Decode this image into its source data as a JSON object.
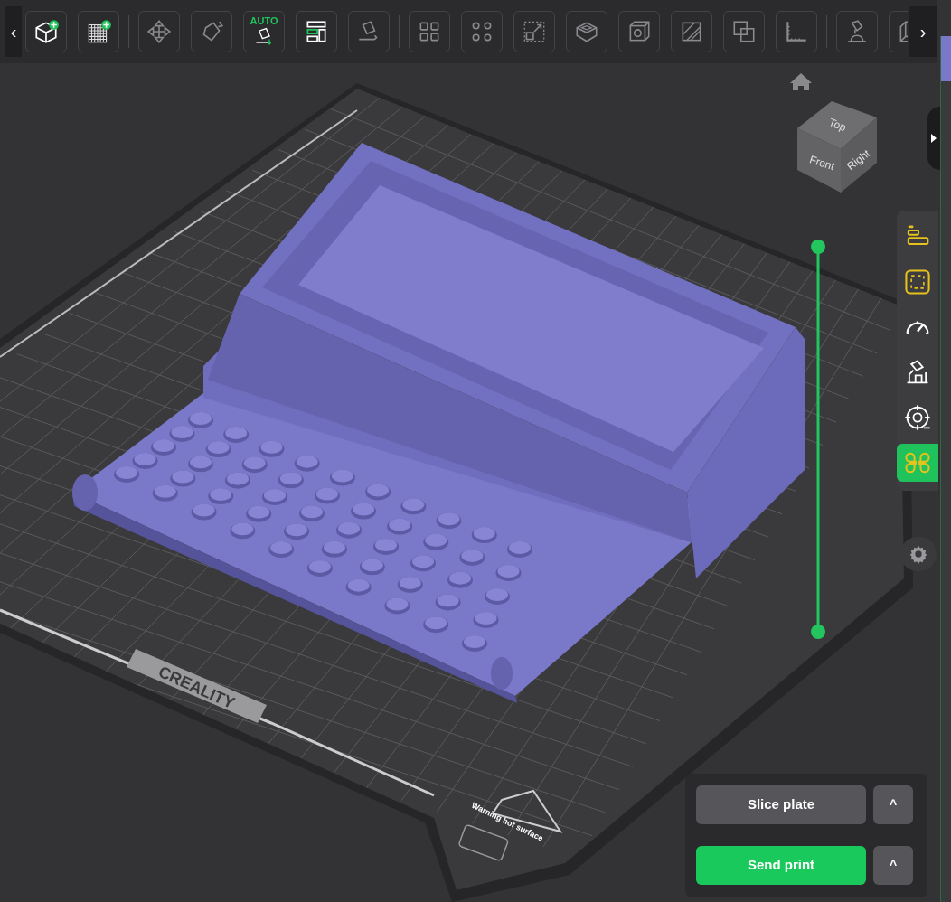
{
  "toolbar": {
    "scroll_left": "‹",
    "scroll_right": "›",
    "groups": [
      [
        {
          "kind": "cube-plus"
        },
        {
          "kind": "grid-plus"
        }
      ],
      [
        {
          "kind": "move"
        },
        {
          "kind": "rotate"
        },
        {
          "kind": "auto-orient",
          "label": "AUTO"
        },
        {
          "kind": "arrange"
        },
        {
          "kind": "lay-flat"
        }
      ],
      [
        {
          "kind": "split-objects"
        },
        {
          "kind": "split-parts"
        },
        {
          "kind": "scale"
        },
        {
          "kind": "tray"
        },
        {
          "kind": "cube"
        },
        {
          "kind": "hatch"
        },
        {
          "kind": "overlap"
        },
        {
          "kind": "ruler"
        }
      ],
      [
        {
          "kind": "paint"
        },
        {
          "kind": "seam"
        }
      ]
    ]
  },
  "layer_slider": {
    "upper": {
      "level": 1
    },
    "lower": {
      "level": 0
    }
  },
  "view_cube": {
    "top": "Top",
    "front": "Front",
    "right": "Right"
  },
  "bed": {
    "brand": "CREALITY",
    "warning": "Warning hot surface"
  },
  "sidebar": {
    "items": [
      {
        "kind": "layers",
        "highlighted": true,
        "selected": false
      },
      {
        "kind": "frame",
        "highlighted": true,
        "selected": false
      },
      {
        "kind": "gauge",
        "highlighted": false,
        "selected": false
      },
      {
        "kind": "support",
        "highlighted": false,
        "selected": false
      },
      {
        "kind": "target",
        "highlighted": false,
        "selected": false
      },
      {
        "kind": "clover",
        "highlighted": true,
        "selected": true
      }
    ]
  },
  "actions": [
    {
      "label": "Slice plate",
      "kind": "secondary",
      "menu": "^"
    },
    {
      "label": "Send print",
      "kind": "primary",
      "menu": "^"
    }
  ]
}
